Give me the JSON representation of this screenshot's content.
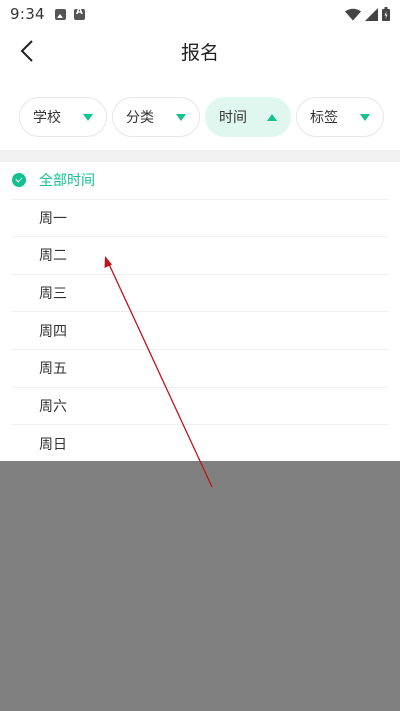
{
  "status_bar": {
    "time": "9:34"
  },
  "header": {
    "title": "报名"
  },
  "filters": [
    {
      "label": "学校",
      "state": "collapsed"
    },
    {
      "label": "分类",
      "state": "collapsed"
    },
    {
      "label": "时间",
      "state": "expanded"
    },
    {
      "label": "标签",
      "state": "collapsed"
    }
  ],
  "time_options": [
    {
      "label": "全部时间",
      "selected": true
    },
    {
      "label": "周一",
      "selected": false
    },
    {
      "label": "周二",
      "selected": false
    },
    {
      "label": "周三",
      "selected": false
    },
    {
      "label": "周四",
      "selected": false
    },
    {
      "label": "周五",
      "selected": false
    },
    {
      "label": "周六",
      "selected": false
    },
    {
      "label": "周日",
      "selected": false
    }
  ],
  "colors": {
    "accent": "#12c28e",
    "chip_active_bg": "#dff7ef",
    "overlay": "#808080",
    "annotation_arrow": "#c0141c"
  }
}
